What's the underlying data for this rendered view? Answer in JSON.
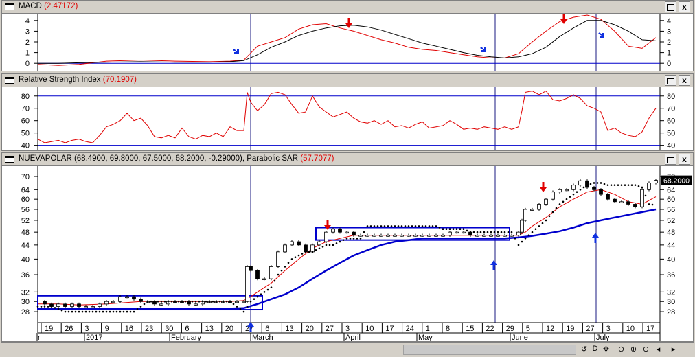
{
  "macd_panel": {
    "title": "MACD",
    "value": "(2.47172)",
    "y_ticks": [
      "4",
      "3",
      "2",
      "1",
      "0"
    ]
  },
  "rsi_panel": {
    "title": "Relative Strength Index",
    "value": "(70.1907)",
    "y_ticks": [
      "80",
      "70",
      "60",
      "50",
      "40"
    ]
  },
  "price_panel": {
    "title": "NUEVAPOLAR (68.4900, 69.8000, 67.5000, 68.2000, -0.29000), Parabolic SAR",
    "value": "(57.7077)",
    "y_ticks": [
      "70",
      "64",
      "60",
      "56",
      "52",
      "48",
      "44",
      "40",
      "36",
      "32",
      "30",
      "28"
    ],
    "last_price_label": "68.2000",
    "x_day_labels": [
      "19",
      "26",
      "3",
      "9",
      "16",
      "23",
      "30",
      "6",
      "13",
      "20",
      "27",
      "6",
      "13",
      "20",
      "27",
      "3",
      "10",
      "17",
      "24",
      "1",
      "8",
      "15",
      "22",
      "29",
      "5",
      "12",
      "19",
      "27",
      "3",
      "10",
      "17"
    ],
    "x_month_labels": [
      "r",
      "2017",
      "February",
      "March",
      "April",
      "May",
      "June",
      "July"
    ]
  },
  "window_buttons": {
    "max": "",
    "close": "x"
  },
  "bottom_tools": [
    "↺",
    "D",
    "✥",
    "⊖",
    "⊕",
    "⊕",
    "◂",
    "▸"
  ],
  "colors": {
    "macd_line": "#000000",
    "signal_line": "#e00000",
    "sar_dots": "#000000",
    "ma_short": "#e00000",
    "ma_long": "#0000cc",
    "markers_down": "#e00000",
    "markers_up": "#1030e0",
    "boxes": "#0000cc"
  },
  "chart_data": [
    {
      "type": "line",
      "title": "MACD (2.47172)",
      "ylim": [
        -0.5,
        4.5
      ],
      "series": [
        {
          "x": [
            0,
            30,
            60,
            100,
            150,
            200,
            250,
            280,
            300,
            320,
            340,
            360,
            380,
            400,
            420,
            440,
            460,
            480,
            500,
            520,
            540,
            560,
            580,
            600,
            620,
            640,
            660,
            680,
            700,
            720,
            740,
            760,
            780,
            800,
            820,
            840,
            860,
            880,
            900
          ],
          "values": [
            0.0,
            0.0,
            0.05,
            0.1,
            0.15,
            0.1,
            0.1,
            0.15,
            0.25,
            0.8,
            1.5,
            2.0,
            2.6,
            3.0,
            3.3,
            3.5,
            3.55,
            3.4,
            3.1,
            2.7,
            2.3,
            1.9,
            1.6,
            1.3,
            1.0,
            0.75,
            0.6,
            0.5,
            0.6,
            0.9,
            1.5,
            2.5,
            3.3,
            4.0,
            4.0,
            3.6,
            3.0,
            2.2,
            2.1
          ]
        },
        {
          "x": [
            0,
            30,
            60,
            100,
            150,
            200,
            250,
            280,
            300,
            320,
            340,
            360,
            380,
            400,
            420,
            440,
            460,
            480,
            500,
            520,
            540,
            560,
            580,
            600,
            620,
            640,
            660,
            680,
            700,
            720,
            740,
            760,
            780,
            800,
            820,
            840,
            860,
            880,
            900
          ],
          "values": [
            -0.1,
            -0.2,
            -0.1,
            0.2,
            0.3,
            0.2,
            0.15,
            0.2,
            0.3,
            1.6,
            2.0,
            2.4,
            3.2,
            3.6,
            3.7,
            3.3,
            3.0,
            2.6,
            2.2,
            1.9,
            1.5,
            1.3,
            1.2,
            1.0,
            0.8,
            0.6,
            0.5,
            0.5,
            0.9,
            2.0,
            3.0,
            3.9,
            4.3,
            4.5,
            4.1,
            3.0,
            1.6,
            1.4,
            2.4
          ]
        }
      ]
    },
    {
      "type": "line",
      "title": "Relative Strength Index (70.1907)",
      "ylim": [
        37,
        86
      ],
      "series": [
        {
          "x": [
            0,
            10,
            20,
            30,
            40,
            50,
            60,
            70,
            80,
            90,
            100,
            110,
            120,
            130,
            140,
            150,
            160,
            170,
            180,
            190,
            200,
            210,
            220,
            230,
            240,
            250,
            260,
            270,
            280,
            290,
            300,
            305,
            310,
            320,
            330,
            340,
            350,
            360,
            370,
            380,
            390,
            400,
            410,
            420,
            430,
            440,
            450,
            460,
            470,
            480,
            490,
            500,
            510,
            520,
            530,
            540,
            550,
            560,
            570,
            580,
            590,
            600,
            610,
            620,
            630,
            640,
            650,
            660,
            670,
            680,
            690,
            700,
            705,
            710,
            720,
            730,
            740,
            750,
            760,
            770,
            780,
            790,
            800,
            810,
            820,
            830,
            840,
            850,
            860,
            870,
            880,
            890,
            900
          ],
          "values": [
            45,
            42,
            43,
            44,
            42,
            44,
            45,
            43,
            42,
            48,
            55,
            57,
            60,
            66,
            60,
            62,
            56,
            47,
            46,
            48,
            46,
            54,
            47,
            45,
            48,
            47,
            50,
            47,
            55,
            52,
            52,
            83,
            75,
            68,
            73,
            82,
            83,
            81,
            73,
            66,
            67,
            80,
            71,
            67,
            63,
            65,
            67,
            62,
            59,
            58,
            60,
            57,
            60,
            55,
            56,
            54,
            57,
            59,
            54,
            55,
            56,
            60,
            57,
            53,
            54,
            53,
            55,
            54,
            53,
            55,
            53,
            55,
            68,
            83,
            84,
            81,
            84,
            77,
            76,
            78,
            81,
            78,
            72,
            70,
            67,
            52,
            54,
            50,
            48,
            47,
            51,
            62,
            70
          ]
        }
      ]
    },
    {
      "type": "line",
      "title": "NUEVAPOLAR (68.4900, 69.8000, 67.5000, 68.2000, -0.29000), Parabolic SAR (57.7077)",
      "ylim": [
        26,
        73
      ],
      "series": [
        {
          "name": "NUEVAPOLAR",
          "x": [
            0,
            10,
            20,
            30,
            40,
            50,
            60,
            70,
            80,
            90,
            100,
            110,
            120,
            130,
            140,
            150,
            160,
            170,
            180,
            190,
            200,
            210,
            220,
            230,
            240,
            250,
            260,
            270,
            280,
            290,
            300,
            305,
            310,
            320,
            330,
            340,
            350,
            360,
            370,
            380,
            390,
            400,
            410,
            420,
            430,
            440,
            450,
            460,
            470,
            480,
            490,
            500,
            510,
            520,
            530,
            540,
            550,
            560,
            570,
            580,
            590,
            600,
            610,
            620,
            630,
            640,
            650,
            660,
            670,
            680,
            690,
            700,
            705,
            710,
            720,
            730,
            740,
            750,
            760,
            770,
            780,
            790,
            800,
            810,
            820,
            830,
            840,
            850,
            860,
            870,
            880,
            890,
            900
          ],
          "values": [
            30,
            29.5,
            29,
            29.5,
            29,
            29.5,
            29,
            29,
            29,
            29.5,
            30,
            30,
            31,
            31,
            30.5,
            30,
            30,
            29.5,
            29.5,
            30,
            30,
            30,
            29.5,
            29.5,
            30,
            30,
            30,
            30,
            30,
            30,
            30,
            38,
            37,
            35,
            35,
            38,
            42,
            44,
            45,
            44,
            42,
            44,
            45,
            48,
            49,
            48,
            48,
            47,
            47,
            47,
            47,
            47,
            47,
            47,
            47,
            47,
            47,
            47,
            47,
            47,
            47,
            48,
            48,
            48,
            47,
            47,
            47,
            47,
            47,
            47,
            47,
            48,
            52,
            56,
            56,
            58,
            60,
            63,
            64,
            64,
            66,
            68,
            65,
            64,
            62,
            60,
            59,
            59,
            58,
            57,
            64,
            67,
            68.2
          ]
        },
        {
          "name": "Parabolic SAR",
          "x": [
            0,
            20,
            40,
            60,
            80,
            100,
            120,
            140,
            160,
            180,
            200,
            220,
            240,
            260,
            280,
            300,
            305,
            310,
            320,
            330,
            340,
            350,
            360,
            370,
            380,
            390,
            400,
            410,
            420,
            430,
            440,
            450,
            460,
            470,
            480,
            490,
            500,
            510,
            520,
            530,
            540,
            550,
            560,
            570,
            580,
            590,
            600,
            610,
            620,
            630,
            640,
            650,
            660,
            670,
            680,
            690,
            700,
            705,
            710,
            720,
            730,
            740,
            750,
            760,
            770,
            780,
            790,
            800,
            810,
            820,
            830,
            840,
            850,
            860,
            870,
            880,
            890,
            900
          ],
          "values": [
            29,
            29,
            28,
            28,
            28,
            28,
            28,
            28,
            30,
            30,
            30,
            30,
            30,
            30,
            30,
            28,
            29,
            30,
            31,
            32,
            33,
            36,
            38,
            40,
            41,
            42,
            42,
            43,
            44,
            44,
            45,
            46,
            46,
            46,
            50,
            50,
            50,
            50,
            50,
            50,
            50,
            50,
            50,
            50,
            50,
            49,
            49,
            49,
            49,
            48,
            48,
            48,
            48,
            48,
            48,
            48,
            44,
            45,
            46,
            48,
            50,
            52,
            55,
            58,
            60,
            62,
            64,
            66,
            67,
            67,
            66,
            66,
            66,
            66,
            66,
            65,
            58,
            57.7
          ]
        },
        {
          "name": "MA short",
          "x": [
            0,
            30,
            60,
            100,
            150,
            200,
            250,
            280,
            300,
            310,
            320,
            340,
            360,
            380,
            400,
            420,
            440,
            460,
            480,
            500,
            520,
            540,
            560,
            580,
            600,
            620,
            640,
            660,
            680,
            700,
            710,
            720,
            740,
            760,
            780,
            800,
            820,
            840,
            860,
            880,
            900
          ],
          "values": [
            29.5,
            29.5,
            29.3,
            29.5,
            30,
            30,
            30,
            30,
            30.2,
            31,
            32,
            34,
            37,
            40,
            43,
            45,
            46,
            47,
            47,
            47,
            47,
            47,
            47,
            47,
            47,
            47,
            47,
            47,
            47,
            47,
            48,
            50,
            53,
            57,
            60,
            63,
            64,
            62,
            59,
            58,
            61
          ]
        },
        {
          "name": "MA long",
          "x": [
            0,
            50,
            100,
            150,
            200,
            250,
            300,
            320,
            340,
            360,
            380,
            400,
            420,
            440,
            460,
            480,
            500,
            520,
            540,
            560,
            580,
            600,
            620,
            640,
            660,
            680,
            700,
            720,
            740,
            760,
            780,
            800,
            820,
            840,
            860,
            880,
            900
          ],
          "values": [
            28.5,
            28.5,
            28.5,
            28.5,
            28.5,
            28.5,
            28.7,
            29.5,
            30.5,
            31.5,
            33,
            35,
            37,
            39,
            41,
            42.5,
            44,
            45,
            45.5,
            46,
            46,
            46,
            46,
            46,
            46,
            46,
            46.3,
            46.8,
            47.5,
            48.3,
            49.5,
            51,
            52,
            53,
            54,
            55,
            56
          ]
        }
      ]
    }
  ]
}
